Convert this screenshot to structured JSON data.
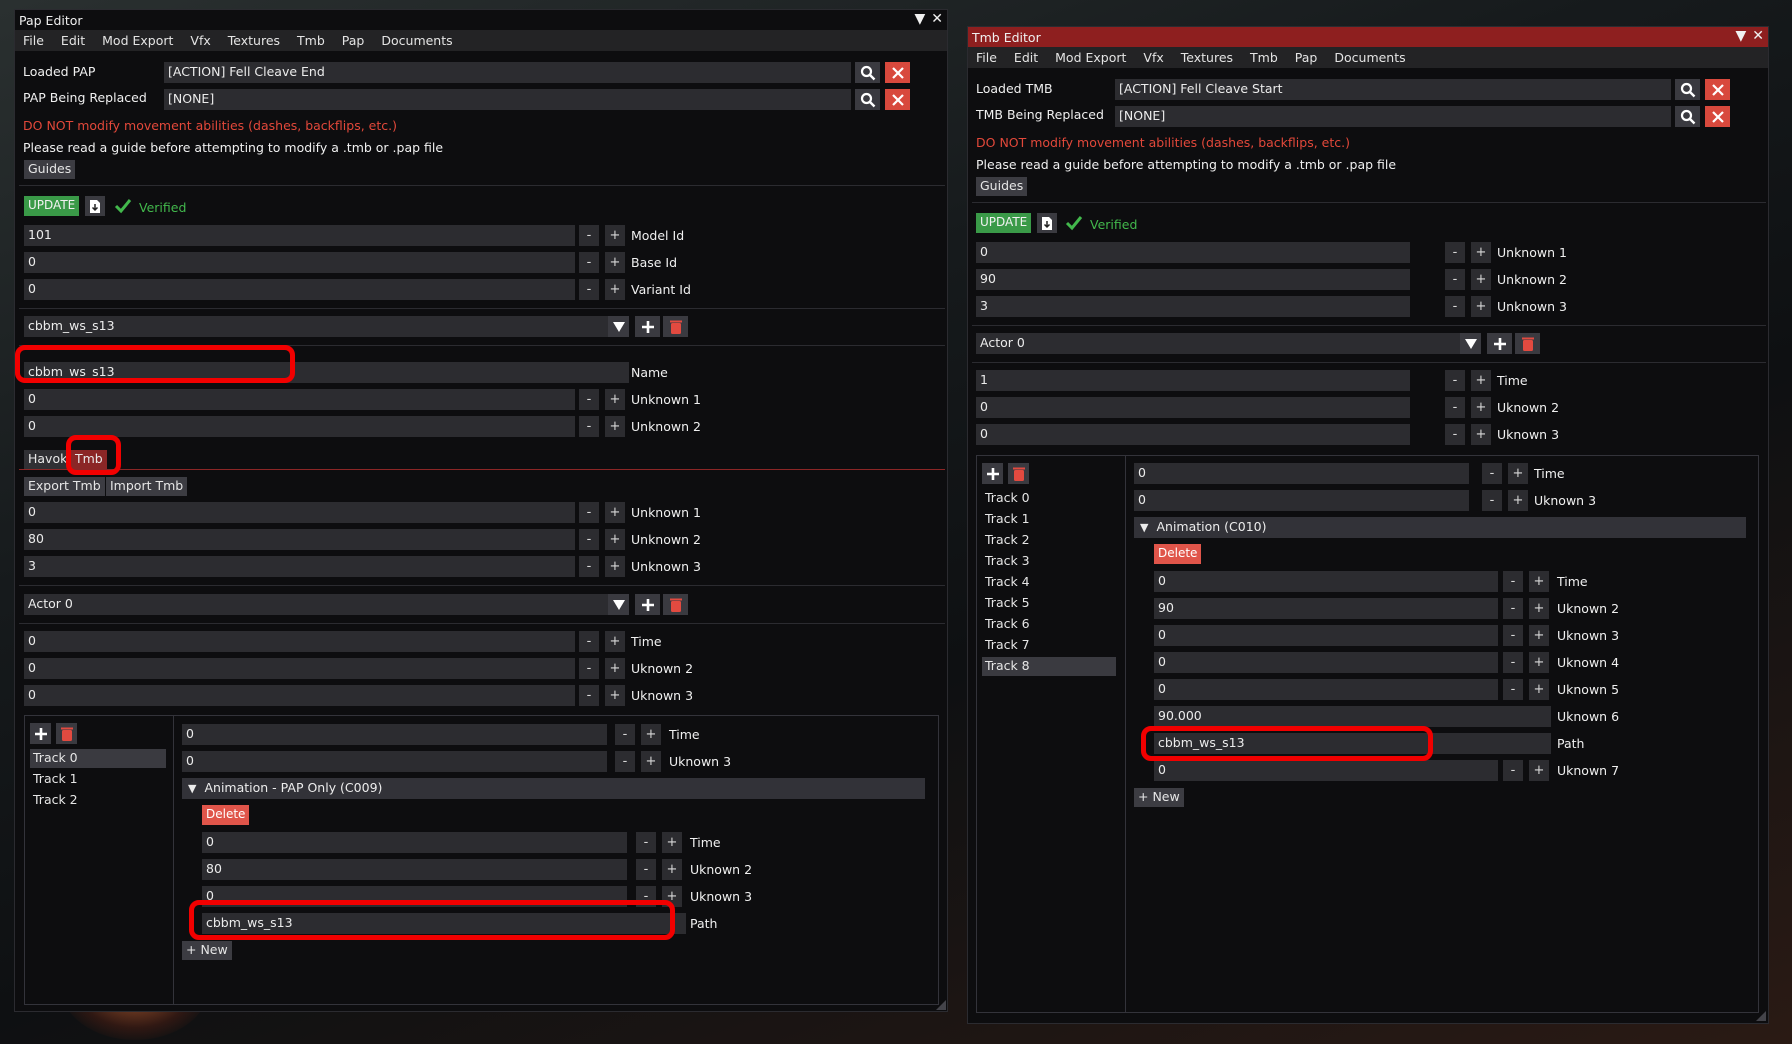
{
  "pap": {
    "title": "Pap Editor",
    "menu": [
      "File",
      "Edit",
      "Mod Export",
      "Vfx",
      "Textures",
      "Tmb",
      "Pap",
      "Documents"
    ],
    "loaded_label": "Loaded PAP",
    "loaded_value": "[ACTION] Fell Cleave End",
    "replaced_label": "PAP Being Replaced",
    "replaced_value": "[NONE]",
    "warning": "DO NOT modify movement abilities (dashes, backflips, etc.)",
    "guide_text": "Please read a guide before attempting to modify a .tmb or .pap file",
    "guides_btn": "Guides",
    "update_btn": "UPDATE",
    "verified": "Verified",
    "model": [
      {
        "v": "101",
        "l": "Model Id"
      },
      {
        "v": "0",
        "l": "Base Id"
      },
      {
        "v": "0",
        "l": "Variant Id"
      }
    ],
    "anim_select": "cbbm_ws_s13",
    "name_value": "cbbm_ws_s13",
    "name_label": "Name",
    "anim_fields": [
      {
        "v": "0",
        "l": "Unknown 1"
      },
      {
        "v": "0",
        "l": "Unknown 2"
      }
    ],
    "tabs": [
      "Havok",
      "Tmb"
    ],
    "export_btn": "Export Tmb",
    "import_btn": "Import Tmb",
    "tmb_fields": [
      {
        "v": "0",
        "l": "Unknown 1"
      },
      {
        "v": "80",
        "l": "Unknown 2"
      },
      {
        "v": "3",
        "l": "Unknown 3"
      }
    ],
    "actor_select": "Actor 0",
    "actor_fields": [
      {
        "v": "0",
        "l": "Time"
      },
      {
        "v": "0",
        "l": "Uknown 2"
      },
      {
        "v": "0",
        "l": "Uknown 3"
      }
    ],
    "tracks": [
      "Track 0",
      "Track 1",
      "Track 2"
    ],
    "track_fields": [
      {
        "v": "0",
        "l": "Time"
      },
      {
        "v": "0",
        "l": "Uknown 3"
      }
    ],
    "entry_header": "Animation - PAP Only (C009)",
    "delete_btn": "Delete",
    "entry_fields": [
      {
        "v": "0",
        "l": "Time"
      },
      {
        "v": "80",
        "l": "Uknown 2"
      },
      {
        "v": "0",
        "l": "Uknown 3"
      }
    ],
    "path_value": "cbbm_ws_s13",
    "path_label": "Path",
    "new_btn": "+ New"
  },
  "tmb": {
    "title": "Tmb Editor",
    "menu": [
      "File",
      "Edit",
      "Mod Export",
      "Vfx",
      "Textures",
      "Tmb",
      "Pap",
      "Documents"
    ],
    "loaded_label": "Loaded TMB",
    "loaded_value": "[ACTION] Fell Cleave Start",
    "replaced_label": "TMB Being Replaced",
    "replaced_value": "[NONE]",
    "warning": "DO NOT modify movement abilities (dashes, backflips, etc.)",
    "guide_text": "Please read a guide before attempting to modify a .tmb or .pap file",
    "guides_btn": "Guides",
    "update_btn": "UPDATE",
    "verified": "Verified",
    "top_fields": [
      {
        "v": "0",
        "l": "Unknown 1"
      },
      {
        "v": "90",
        "l": "Unknown 2"
      },
      {
        "v": "3",
        "l": "Unknown 3"
      }
    ],
    "actor_select": "Actor 0",
    "actor_fields": [
      {
        "v": "1",
        "l": "Time"
      },
      {
        "v": "0",
        "l": "Uknown 2"
      },
      {
        "v": "0",
        "l": "Uknown 3"
      }
    ],
    "tracks": [
      "Track 0",
      "Track 1",
      "Track 2",
      "Track 3",
      "Track 4",
      "Track 5",
      "Track 6",
      "Track 7",
      "Track 8"
    ],
    "track_fields": [
      {
        "v": "0",
        "l": "Time"
      },
      {
        "v": "0",
        "l": "Uknown 3"
      }
    ],
    "entry_header": "Animation (C010)",
    "delete_btn": "Delete",
    "entry_fields": [
      {
        "v": "0",
        "l": "Time"
      },
      {
        "v": "90",
        "l": "Uknown 2"
      },
      {
        "v": "0",
        "l": "Uknown 3"
      },
      {
        "v": "0",
        "l": "Uknown 4"
      },
      {
        "v": "0",
        "l": "Uknown 5"
      }
    ],
    "unk6_value": "90.000",
    "unk6_label": "Uknown 6",
    "path_value": "cbbm_ws_s13",
    "path_label": "Path",
    "unk7_value": "0",
    "unk7_label": "Uknown 7",
    "new_btn": "+ New"
  },
  "colors": {
    "highlight": "#f20000",
    "verified": "#42b84c",
    "warning": "#e2483a",
    "update": "#3a9a48",
    "tab_active": "#8b2626",
    "tmb_titlebar": "#8e1f1f"
  }
}
